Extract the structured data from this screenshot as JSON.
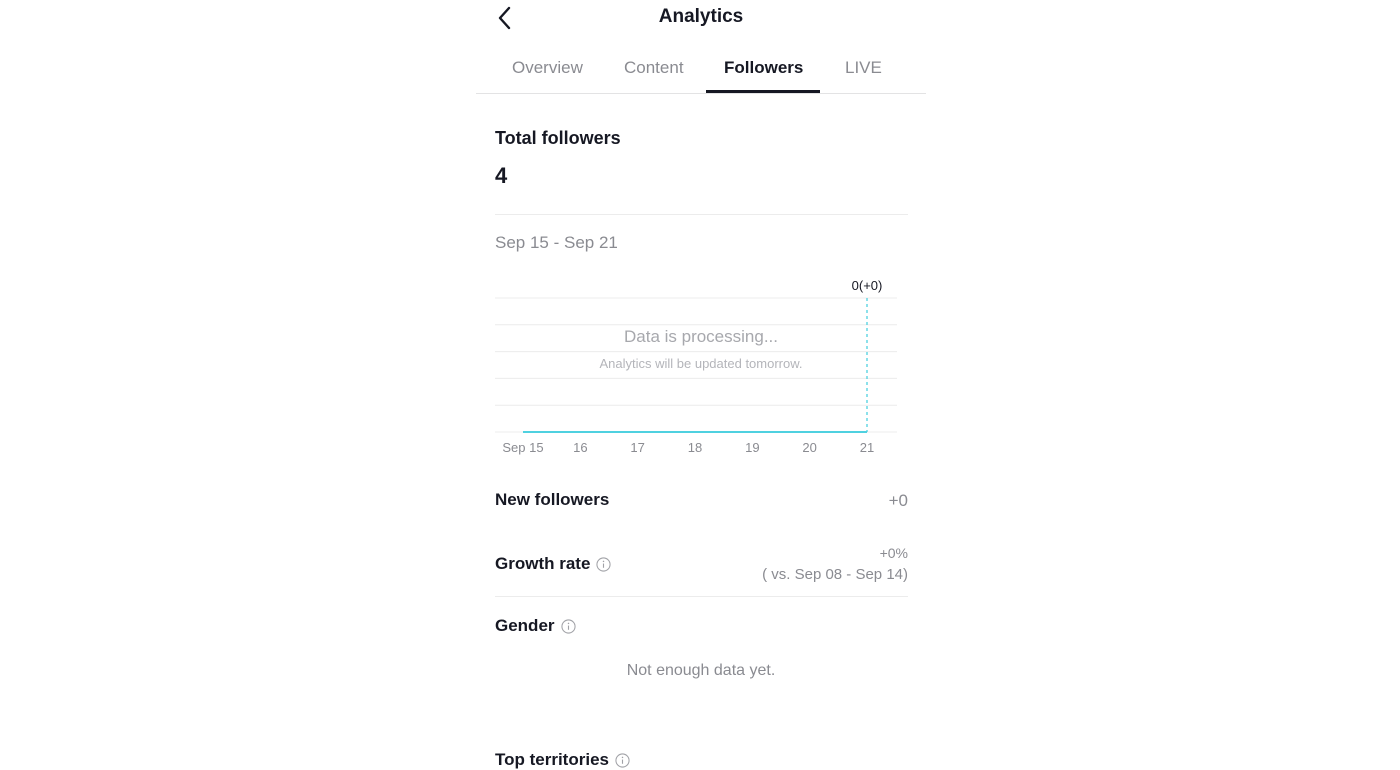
{
  "header": {
    "title": "Analytics",
    "back_icon": "chevron-left-icon"
  },
  "tabs": [
    {
      "label": "Overview",
      "active": false
    },
    {
      "label": "Content",
      "active": false
    },
    {
      "label": "Followers",
      "active": true
    },
    {
      "label": "LIVE",
      "active": false
    }
  ],
  "total_followers": {
    "label": "Total followers",
    "value": "4"
  },
  "date_range": "Sep 15 - Sep 21",
  "chart_data": {
    "type": "line",
    "categories": [
      "Sep 15",
      "16",
      "17",
      "18",
      "19",
      "20",
      "21"
    ],
    "series": [
      {
        "values": [
          0,
          0,
          0,
          0,
          0,
          0,
          0
        ]
      }
    ],
    "highlight_label": "0(+0)",
    "overlay_title": "Data is processing...",
    "overlay_subtitle": "Analytics will be updated tomorrow.",
    "grid": true,
    "line_color": "#4fd1e0"
  },
  "new_followers": {
    "label": "New followers",
    "value": "+0"
  },
  "growth_rate": {
    "label": "Growth rate",
    "value": "+0%",
    "comparison": "( vs. Sep 08 - Sep 14)"
  },
  "gender": {
    "label": "Gender",
    "empty_text": "Not enough data yet."
  },
  "top_territories": {
    "label": "Top territories"
  }
}
